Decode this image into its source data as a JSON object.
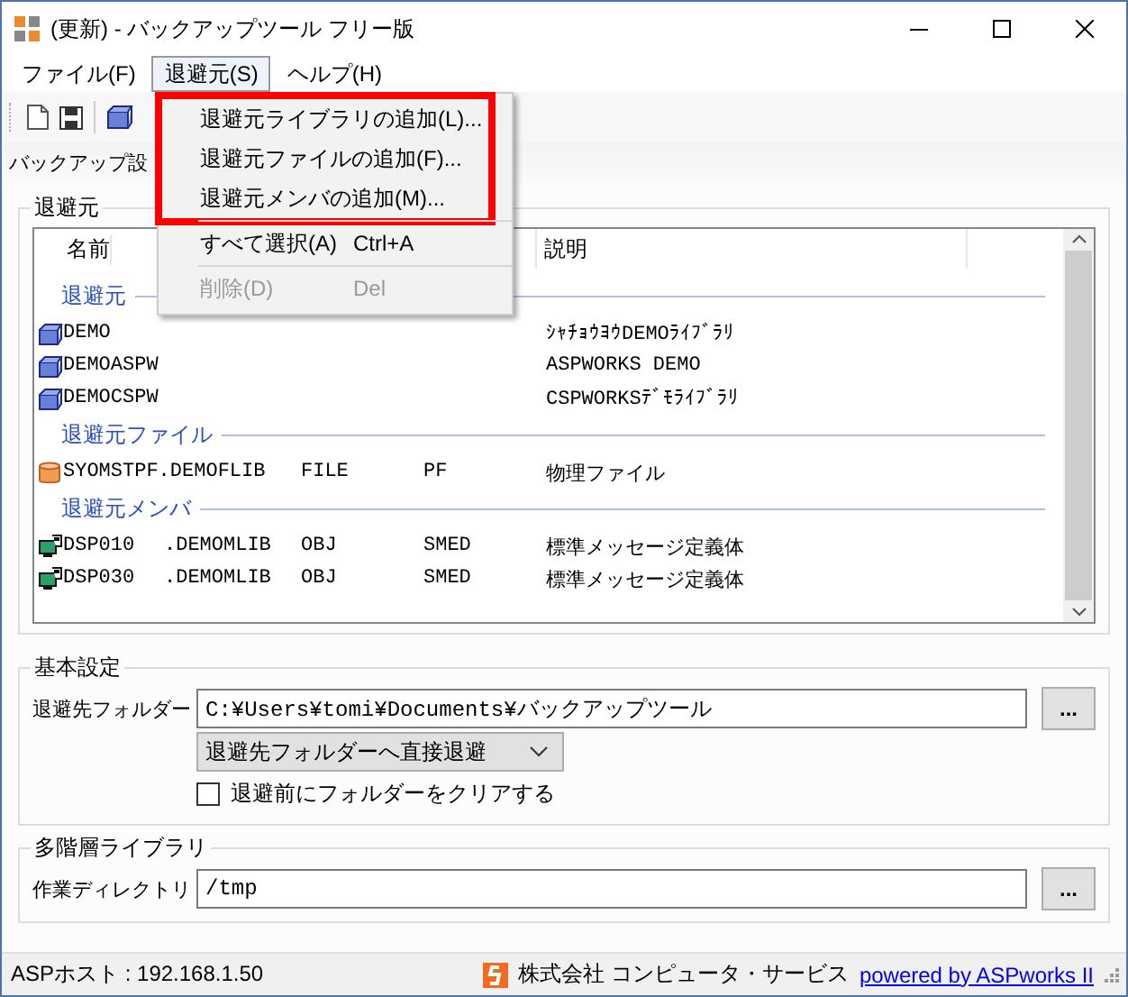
{
  "window": {
    "title": "(更新) - バックアップツール フリー版"
  },
  "menu_bar": [
    {
      "label": "ファイル(F)",
      "selected": false
    },
    {
      "label": "退避元(S)",
      "selected": true
    },
    {
      "label": "ヘルプ(H)",
      "selected": false
    }
  ],
  "tab": {
    "label": "バックアップ設"
  },
  "source_group": {
    "title": "退避元",
    "columns": [
      "名前",
      "説明"
    ],
    "groups": [
      {
        "label": "退避元",
        "kind": "library",
        "rows": [
          {
            "name": "DEMO",
            "description": "ｼｬﾁｮｳﾖｳDEMOﾗｲﾌﾞﾗﾘ"
          },
          {
            "name": "DEMOASPW",
            "description": "ASPWORKS DEMO"
          },
          {
            "name": "DEMOCSPW",
            "description": "CSPWORKSﾃﾞﾓﾗｲﾌﾞﾗﾘ"
          }
        ]
      },
      {
        "label": "退避元ファイル",
        "kind": "file",
        "rows": [
          {
            "name": "SYOMSTPF.DEMOFLIB",
            "type": "FILE",
            "attribute": "PF",
            "description": "物理ファイル"
          }
        ]
      },
      {
        "label": "退避元メンバ",
        "kind": "member",
        "rows": [
          {
            "name": "DSP010",
            "library": ".DEMOMLIB",
            "type": "OBJ",
            "attribute": "SMED",
            "description": "標準メッセージ定義体"
          },
          {
            "name": "DSP030",
            "library": ".DEMOMLIB",
            "type": "OBJ",
            "attribute": "SMED",
            "description": "標準メッセージ定義体"
          }
        ]
      }
    ]
  },
  "basic_settings": {
    "title": "基本設定",
    "folder_label": "退避先フォルダー",
    "folder_value": "C:¥Users¥tomi¥Documents¥バックアップツール",
    "browse_button": "...",
    "mode_value": "退避先フォルダーへ直接退避",
    "clear_checkbox": {
      "label": "退避前にフォルダーをクリアする",
      "checked": false
    }
  },
  "multi_level_library": {
    "title": "多階層ライブラリ",
    "workdir_label": "作業ディレクトリ",
    "workdir_value": "/tmp",
    "browse_button": "..."
  },
  "status_bar": {
    "host": "ASPホスト : 192.168.1.50",
    "company": "株式会社 コンピュータ・サービス",
    "link": "powered by ASPworks II"
  },
  "context_menu": {
    "sections": [
      {
        "highlighted": true,
        "items": [
          {
            "label": "退避元ライブラリの追加(L)...",
            "disabled": false
          },
          {
            "label": "退避元ファイルの追加(F)...",
            "disabled": false
          },
          {
            "label": "退避元メンバの追加(M)...",
            "disabled": false
          }
        ]
      },
      {
        "highlighted": false,
        "items": [
          {
            "label": "すべて選択(A)",
            "shortcut": "Ctrl+A",
            "disabled": false
          }
        ]
      },
      {
        "highlighted": false,
        "items": [
          {
            "label": "削除(D)",
            "shortcut": "Del",
            "disabled": true
          }
        ]
      }
    ]
  }
}
